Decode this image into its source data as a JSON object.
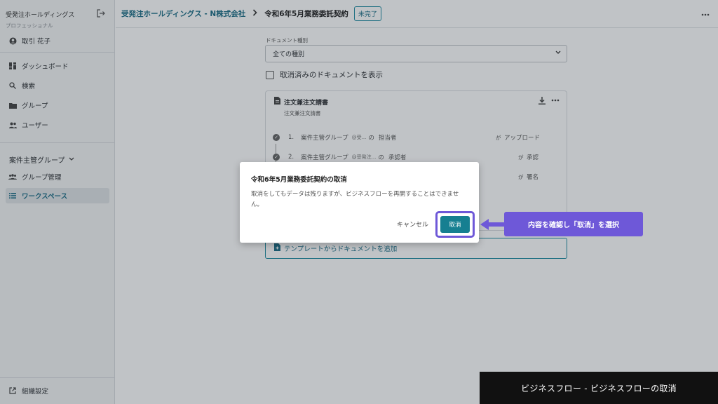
{
  "sidebar": {
    "org_name": "受発注ホールディングス",
    "org_plan": "プロフェッショナル",
    "user": "取引 花子",
    "nav": [
      "ダッシュボード",
      "検索",
      "グループ",
      "ユーザー"
    ],
    "group_heading": "案件主管グループ",
    "group_items": [
      "グループ管理",
      "ワークスペース"
    ],
    "footer": "組織設定"
  },
  "header": {
    "breadcrumb_parent": "受発注ホールディングス - N株式会社",
    "breadcrumb_current": "令和6年5月業務委託契約",
    "status_badge": "未完了"
  },
  "main": {
    "doc_type_label": "ドキュメント種別",
    "doc_type_value": "全ての種別",
    "show_cancelled_label": "取消済みのドキュメントを表示",
    "card": {
      "title": "注文兼注文請書",
      "subtitle": "注文兼注文請書",
      "steps": [
        {
          "num": "1.",
          "group": "案件主管グループ",
          "tag": "@受...",
          "of": "の",
          "role_owner": "担当者",
          "ga": "が",
          "action": "アップロード"
        },
        {
          "num": "2.",
          "group": "案件主管グループ",
          "tag": "@受発注...",
          "of": "の",
          "role_owner": "承認者",
          "ga": "が",
          "action": "承認"
        },
        {
          "ga": "が",
          "action": "署名"
        }
      ]
    },
    "add_from_template": "テンプレートからドキュメントを追加"
  },
  "dialog": {
    "title": "令和6年5月業務委託契約の取消",
    "body": "取消をしてもデータは残りますが、ビジネスフローを再開することはできません。",
    "cancel_label": "キャンセル",
    "confirm_label": "取消"
  },
  "callout": "内容を確認し「取消」を選択",
  "caption": "ビジネスフロー - ビジネスフローの取消",
  "colors": {
    "accent": "#1d6e87",
    "highlight": "#6e58d8",
    "confirm_button": "#167f91"
  }
}
